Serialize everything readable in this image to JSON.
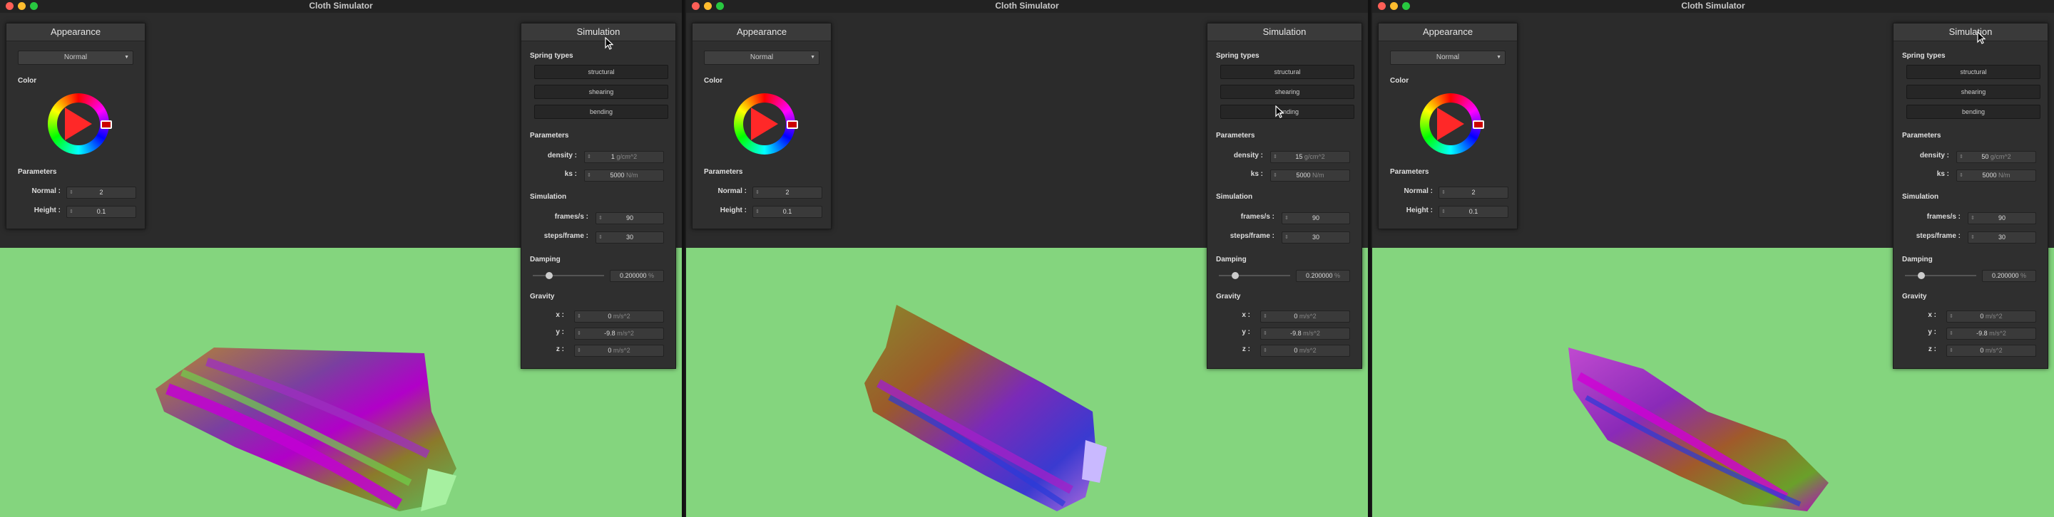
{
  "windows": [
    {
      "title": "Cloth Simulator",
      "appearance": {
        "title": "Appearance",
        "mode": "Normal",
        "color_label": "Color",
        "params_label": "Parameters",
        "normal_label": "Normal :",
        "normal_value": "2",
        "height_label": "Height :",
        "height_value": "0.1"
      },
      "simulation": {
        "title": "Simulation",
        "spring_label": "Spring types",
        "spring_buttons": [
          "structural",
          "shearing",
          "bending"
        ],
        "params_label": "Parameters",
        "density_label": "density :",
        "density_value": "1",
        "density_unit": "g/cm^2",
        "ks_label": "ks :",
        "ks_value": "5000",
        "ks_unit": "N/m",
        "sim_label": "Simulation",
        "fps_label": "frames/s :",
        "fps_value": "90",
        "spf_label": "steps/frame :",
        "spf_value": "30",
        "damping_label": "Damping",
        "damping_value": "0.200000",
        "damping_unit": "%",
        "damping_fraction": 0.2,
        "gravity_label": "Gravity",
        "gx_label": "x :",
        "gx": "0",
        "gy_label": "y :",
        "gy": "-9.8",
        "gz_label": "z :",
        "gz": "0",
        "g_unit": "m/s^2"
      }
    },
    {
      "title": "Cloth Simulator",
      "appearance": {
        "title": "Appearance",
        "mode": "Normal",
        "color_label": "Color",
        "params_label": "Parameters",
        "normal_label": "Normal :",
        "normal_value": "2",
        "height_label": "Height :",
        "height_value": "0.1"
      },
      "simulation": {
        "title": "Simulation",
        "spring_label": "Spring types",
        "spring_buttons": [
          "structural",
          "shearing",
          "bending"
        ],
        "params_label": "Parameters",
        "density_label": "density :",
        "density_value": "15",
        "density_unit": "g/cm^2",
        "ks_label": "ks :",
        "ks_value": "5000",
        "ks_unit": "N/m",
        "sim_label": "Simulation",
        "fps_label": "frames/s :",
        "fps_value": "90",
        "spf_label": "steps/frame :",
        "spf_value": "30",
        "damping_label": "Damping",
        "damping_value": "0.200000",
        "damping_unit": "%",
        "damping_fraction": 0.2,
        "gravity_label": "Gravity",
        "gx_label": "x :",
        "gx": "0",
        "gy_label": "y :",
        "gy": "-9.8",
        "gz_label": "z :",
        "gz": "0",
        "g_unit": "m/s^2"
      }
    },
    {
      "title": "Cloth Simulator",
      "appearance": {
        "title": "Appearance",
        "mode": "Normal",
        "color_label": "Color",
        "params_label": "Parameters",
        "normal_label": "Normal :",
        "normal_value": "2",
        "height_label": "Height :",
        "height_value": "0.1"
      },
      "simulation": {
        "title": "Simulation",
        "spring_label": "Spring types",
        "spring_buttons": [
          "structural",
          "shearing",
          "bending"
        ],
        "params_label": "Parameters",
        "density_label": "density :",
        "density_value": "50",
        "density_unit": "g/cm^2",
        "ks_label": "ks :",
        "ks_value": "5000",
        "ks_unit": "N/m",
        "sim_label": "Simulation",
        "fps_label": "frames/s :",
        "fps_value": "90",
        "spf_label": "steps/frame :",
        "spf_value": "30",
        "damping_label": "Damping",
        "damping_value": "0.200000",
        "damping_unit": "%",
        "damping_fraction": 0.2,
        "gravity_label": "Gravity",
        "gx_label": "x :",
        "gx": "0",
        "gy_label": "y :",
        "gy": "-9.8",
        "gz_label": "z :",
        "gz": "0",
        "g_unit": "m/s^2"
      }
    }
  ],
  "colors": {
    "floor": "#84d57e",
    "panel": "#2f2f2f",
    "accent_red": "#ff2828"
  }
}
